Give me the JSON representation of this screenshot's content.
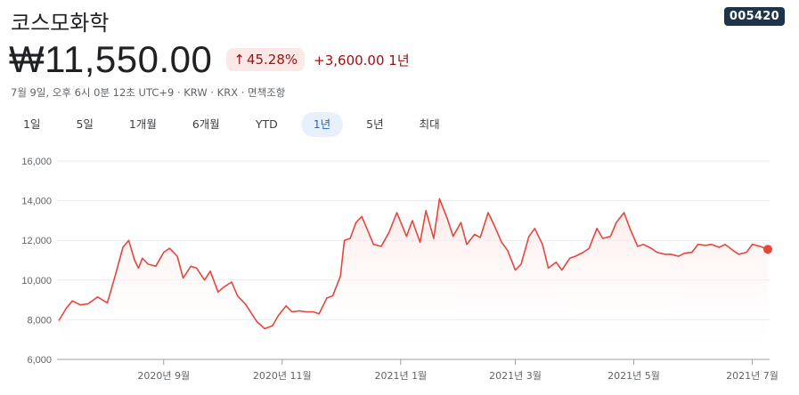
{
  "header": {
    "title": "코스모화학",
    "ticker": "005420",
    "price": "₩11,550.00",
    "change_pct": "45.28%",
    "change_abs": "+3,600.00 1년",
    "meta": "7월 9일, 오후 6시 0분 12초 UTC+9 · KRW · KRX · 면책조항"
  },
  "tabs": [
    {
      "label": "1일",
      "active": false
    },
    {
      "label": "5일",
      "active": false
    },
    {
      "label": "1개월",
      "active": false
    },
    {
      "label": "6개월",
      "active": false
    },
    {
      "label": "YTD",
      "active": false
    },
    {
      "label": "1년",
      "active": true
    },
    {
      "label": "5년",
      "active": false
    },
    {
      "label": "최대",
      "active": false
    }
  ],
  "colors": {
    "line": "#e8453c",
    "fill": "#fce8e6",
    "badge_bg": "#1f3448",
    "active_tab": "#1967d2"
  },
  "chart_data": {
    "type": "area",
    "title": "",
    "xlabel": "",
    "ylabel": "",
    "ylim": [
      6000,
      16000
    ],
    "xlim": [
      "2020-07-09",
      "2021-07-09"
    ],
    "yticks": [
      {
        "value": 6000,
        "label": "6,000"
      },
      {
        "value": 8000,
        "label": "8,000"
      },
      {
        "value": 10000,
        "label": "10,000"
      },
      {
        "value": 12000,
        "label": "12,000"
      },
      {
        "value": 14000,
        "label": "14,000"
      },
      {
        "value": 16000,
        "label": "16,000"
      }
    ],
    "xticks": [
      {
        "date": "2020-09-01",
        "label": "2020년 9월"
      },
      {
        "date": "2020-11-01",
        "label": "2020년 11월"
      },
      {
        "date": "2021-01-01",
        "label": "2021년 1월"
      },
      {
        "date": "2021-03-01",
        "label": "2021년 3월"
      },
      {
        "date": "2021-05-01",
        "label": "2021년 5월"
      },
      {
        "date": "2021-07-01",
        "label": "2021년 7월"
      }
    ],
    "grid": true,
    "series": [
      {
        "x": [
          "2020-07-09",
          "2020-07-13",
          "2020-07-16",
          "2020-07-20",
          "2020-07-24",
          "2020-07-29",
          "2020-08-03",
          "2020-08-07",
          "2020-08-11",
          "2020-08-14",
          "2020-08-17",
          "2020-08-19",
          "2020-08-21",
          "2020-08-24",
          "2020-08-26",
          "2020-08-28",
          "2020-09-01",
          "2020-09-04",
          "2020-09-08",
          "2020-09-11",
          "2020-09-15",
          "2020-09-18",
          "2020-09-22",
          "2020-09-25",
          "2020-09-29",
          "2020-10-02",
          "2020-10-06",
          "2020-10-09",
          "2020-10-13",
          "2020-10-16",
          "2020-10-19",
          "2020-10-23",
          "2020-10-27",
          "2020-10-30",
          "2020-11-03",
          "2020-11-06",
          "2020-11-10",
          "2020-11-13",
          "2020-11-17",
          "2020-11-20",
          "2020-11-24",
          "2020-11-27",
          "2020-12-01",
          "2020-12-03",
          "2020-12-06",
          "2020-12-09",
          "2020-12-12",
          "2020-12-15",
          "2020-12-18",
          "2020-12-22",
          "2020-12-26",
          "2020-12-30",
          "2021-01-04",
          "2021-01-07",
          "2021-01-11",
          "2021-01-14",
          "2021-01-18",
          "2021-01-21",
          "2021-01-25",
          "2021-01-28",
          "2021-02-01",
          "2021-02-04",
          "2021-02-08",
          "2021-02-11",
          "2021-02-15",
          "2021-02-18",
          "2021-02-22",
          "2021-02-25",
          "2021-03-01",
          "2021-03-04",
          "2021-03-08",
          "2021-03-11",
          "2021-03-15",
          "2021-03-18",
          "2021-03-22",
          "2021-03-25",
          "2021-03-29",
          "2021-04-01",
          "2021-04-05",
          "2021-04-08",
          "2021-04-12",
          "2021-04-15",
          "2021-04-19",
          "2021-04-22",
          "2021-04-26",
          "2021-04-29",
          "2021-05-03",
          "2021-05-06",
          "2021-05-10",
          "2021-05-13",
          "2021-05-17",
          "2021-05-20",
          "2021-05-24",
          "2021-05-27",
          "2021-05-31",
          "2021-06-03",
          "2021-06-07",
          "2021-06-10",
          "2021-06-14",
          "2021-06-17",
          "2021-06-21",
          "2021-06-24",
          "2021-06-28",
          "2021-07-01",
          "2021-07-05",
          "2021-07-09"
        ],
        "values": [
          7950,
          8600,
          8950,
          8750,
          8800,
          9150,
          8850,
          10200,
          11650,
          12000,
          11000,
          10600,
          11100,
          10800,
          10750,
          10700,
          11400,
          11600,
          11200,
          10100,
          10700,
          10600,
          10000,
          10450,
          9400,
          9650,
          9900,
          9200,
          8800,
          8350,
          7900,
          7550,
          7700,
          8200,
          8700,
          8400,
          8450,
          8400,
          8400,
          8300,
          9100,
          9200,
          10200,
          12000,
          12100,
          12900,
          13200,
          12500,
          11800,
          11700,
          12400,
          13400,
          12200,
          13000,
          11900,
          13500,
          12100,
          14100,
          13100,
          12200,
          12900,
          11800,
          12300,
          12150,
          13400,
          12800,
          11900,
          11500,
          10500,
          10800,
          12200,
          12600,
          11800,
          10600,
          10900,
          10500,
          11100,
          11200,
          11400,
          11600,
          12600,
          12100,
          12200,
          12900,
          13400,
          12600,
          11700,
          11800,
          11600,
          11400,
          11300,
          11300,
          11200,
          11350,
          11400,
          11800,
          11750,
          11800,
          11650,
          11800,
          11500,
          11300,
          11400,
          11800,
          11700,
          11550
        ]
      }
    ],
    "last_value": 11550
  }
}
